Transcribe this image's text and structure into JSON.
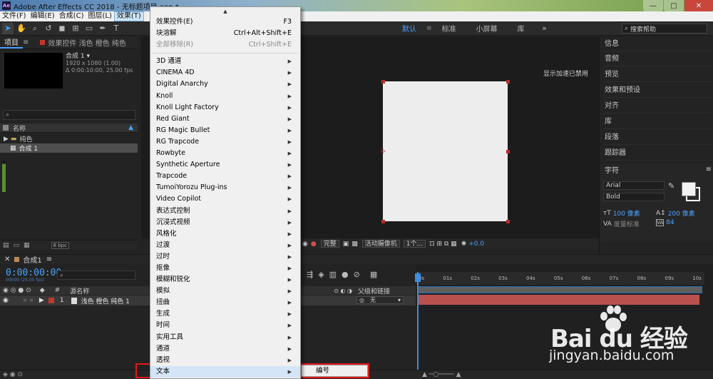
{
  "window": {
    "title": "Adobe After Effects CC 2018 - 无标题项目.aep *",
    "app_icon": "Ae"
  },
  "menubar": {
    "items": [
      "文件(F)",
      "编辑(E)",
      "合成(C)",
      "图层(L)",
      "效果(T)"
    ]
  },
  "workspace": {
    "tabs": [
      "默认",
      "标准",
      "小屏幕",
      "库"
    ],
    "search_placeholder": "搜索帮助"
  },
  "project": {
    "tab": "项目",
    "effects_tab": "效果控件 浅色 橙色 纯色",
    "comp_name": "合成 1 ▾",
    "comp_size": "1920 x 1080 (1.00)",
    "comp_duration": "Δ 0:00:10:00, 25.00 fps",
    "search_placeholder": "",
    "column_name": "名称",
    "rows": [
      {
        "label": "纯色",
        "type": "folder"
      },
      {
        "label": "合成 1",
        "type": "comp"
      }
    ],
    "bpc": "8 bpc"
  },
  "viewer": {
    "accel_note": "显示加速已禁用",
    "quality": "完整",
    "camera": "活动摄像机",
    "views": "1个...",
    "exposure": "+0.0"
  },
  "right_panels": {
    "items": [
      "信息",
      "音频",
      "预览",
      "效果和预设",
      "对齐",
      "库",
      "段落",
      "跟踪器"
    ],
    "character": {
      "title": "字符",
      "font": "Arial",
      "style": "Bold",
      "size": "100 像素",
      "leading": "200 像素",
      "kerning": "度量标准",
      "tracking": "84"
    }
  },
  "timeline": {
    "tab": "合成1",
    "timecode": "0:00:00:00",
    "timecode_sub": "00000 (25.00 fps)",
    "columns": {
      "source": "源名称",
      "parent": "父级和链接"
    },
    "layer": {
      "number": "1",
      "name": "浅色 橙色 纯色 1",
      "parent": "无"
    },
    "ruler": [
      "0s",
      "01s",
      "02s",
      "03s",
      "04s",
      "05s",
      "06s",
      "07s",
      "08s",
      "09s",
      "10s"
    ]
  },
  "effect_menu": {
    "scroll_up": "▲",
    "top_items": [
      {
        "label": "效果控件(E)",
        "shortcut": "F3",
        "disabled": false
      },
      {
        "label": "块溶解",
        "shortcut": "Ctrl+Alt+Shift+E",
        "disabled": false
      },
      {
        "label": "全部移除(R)",
        "shortcut": "Ctrl+Shift+E",
        "disabled": true
      }
    ],
    "items": [
      "3D 通道",
      "CINEMA 4D",
      "Digital Anarchy",
      "Knoll",
      "Knoll Light Factory",
      "Red Giant",
      "RG Magic Bullet",
      "RG Trapcode",
      "Rowbyte",
      "Synthetic Aperture",
      "Trapcode",
      "TumoiYorozu Plug-ins",
      "Video Copilot",
      "表达式控制",
      "沉浸式视频",
      "风格化",
      "过渡",
      "过时",
      "抠像",
      "模糊和锐化",
      "模拟",
      "扭曲",
      "生成",
      "时间",
      "实用工具",
      "通道",
      "透视",
      "文本"
    ],
    "highlighted": "文本",
    "submenu_item": "编号"
  },
  "watermark": {
    "logo": "Bai du 经验",
    "url": "jingyan.baidu.com"
  }
}
